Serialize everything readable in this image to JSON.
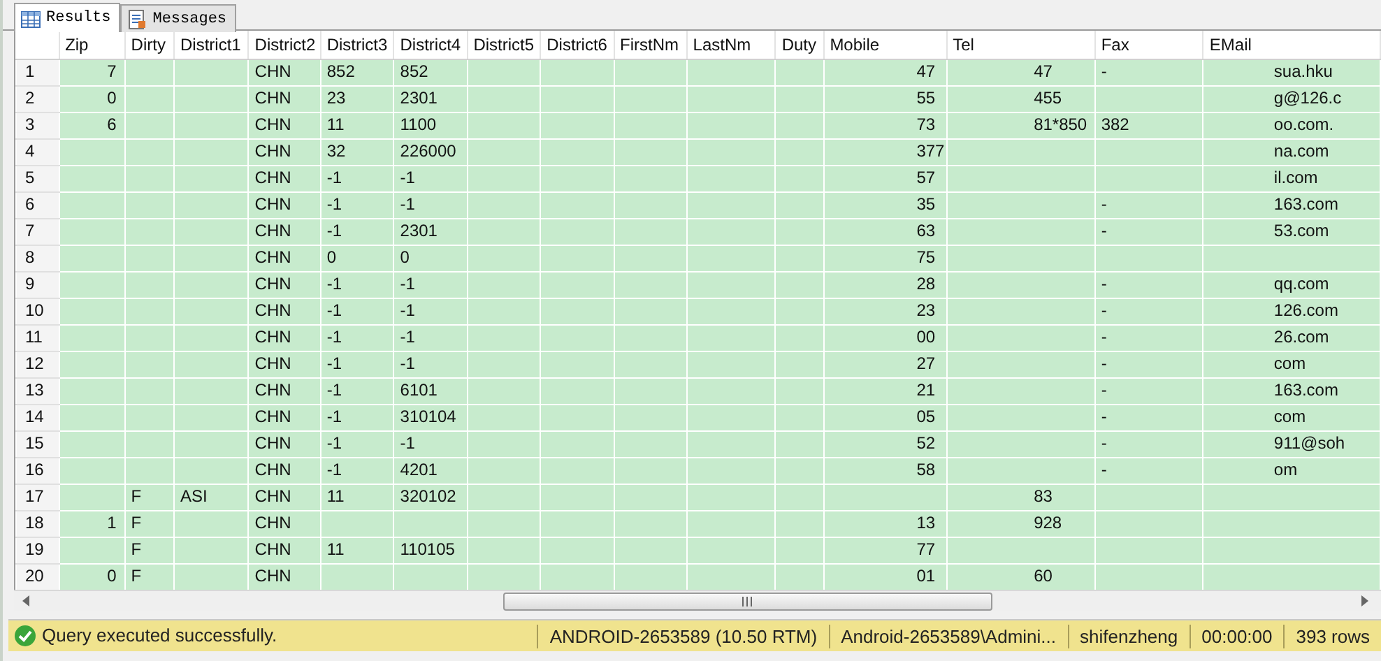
{
  "tabs": [
    {
      "label": "Results",
      "selected": true
    },
    {
      "label": "Messages",
      "selected": false
    }
  ],
  "table": {
    "columns": [
      "Zip",
      "Dirty",
      "District1",
      "District2",
      "District3",
      "District4",
      "District5",
      "District6",
      "FirstNm",
      "LastNm",
      "Duty",
      "Mobile",
      "Tel",
      "Fax",
      "EMail"
    ],
    "rows": [
      {
        "number": "1",
        "cells": [
          "7",
          "",
          "",
          "CHN",
          "852",
          "852",
          "",
          "",
          "",
          "",
          "",
          "47",
          "47",
          "-",
          "sua.hku"
        ]
      },
      {
        "number": "2",
        "cells": [
          "0",
          "",
          "",
          "CHN",
          "23",
          "2301",
          "",
          "",
          "",
          "",
          "",
          "55",
          "455",
          "",
          "g@126.c"
        ]
      },
      {
        "number": "3",
        "cells": [
          "6",
          "",
          "",
          "CHN",
          "11",
          "1100",
          "",
          "",
          "",
          "",
          "",
          "73",
          "81*850",
          "382",
          "oo.com."
        ]
      },
      {
        "number": "4",
        "cells": [
          "",
          "",
          "",
          "CHN",
          "32",
          "226000",
          "",
          "",
          "",
          "",
          "",
          "377",
          "",
          "",
          "na.com"
        ]
      },
      {
        "number": "5",
        "cells": [
          "",
          "",
          "",
          "CHN",
          "-1",
          "-1",
          "",
          "",
          "",
          "",
          "",
          "57",
          "",
          "",
          "il.com"
        ]
      },
      {
        "number": "6",
        "cells": [
          "",
          "",
          "",
          "CHN",
          "-1",
          "-1",
          "",
          "",
          "",
          "",
          "",
          "35",
          "",
          "-",
          "163.com"
        ]
      },
      {
        "number": "7",
        "cells": [
          "",
          "",
          "",
          "CHN",
          "-1",
          "2301",
          "",
          "",
          "",
          "",
          "",
          "63",
          "",
          "-",
          "53.com"
        ]
      },
      {
        "number": "8",
        "cells": [
          "",
          "",
          "",
          "CHN",
          "0",
          "0",
          "",
          "",
          "",
          "",
          "",
          "75",
          "",
          "",
          ""
        ]
      },
      {
        "number": "9",
        "cells": [
          "",
          "",
          "",
          "CHN",
          "-1",
          "-1",
          "",
          "",
          "",
          "",
          "",
          "28",
          "",
          "-",
          "qq.com"
        ]
      },
      {
        "number": "10",
        "cells": [
          "",
          "",
          "",
          "CHN",
          "-1",
          "-1",
          "",
          "",
          "",
          "",
          "",
          "23",
          "",
          "-",
          "126.com"
        ]
      },
      {
        "number": "11",
        "cells": [
          "",
          "",
          "",
          "CHN",
          "-1",
          "-1",
          "",
          "",
          "",
          "",
          "",
          "00",
          "",
          "-",
          "26.com"
        ]
      },
      {
        "number": "12",
        "cells": [
          "",
          "",
          "",
          "CHN",
          "-1",
          "-1",
          "",
          "",
          "",
          "",
          "",
          "27",
          "",
          "-",
          "com"
        ]
      },
      {
        "number": "13",
        "cells": [
          "",
          "",
          "",
          "CHN",
          "-1",
          "6101",
          "",
          "",
          "",
          "",
          "",
          "21",
          "",
          "-",
          "163.com"
        ]
      },
      {
        "number": "14",
        "cells": [
          "",
          "",
          "",
          "CHN",
          "-1",
          "310104",
          "",
          "",
          "",
          "",
          "",
          "05",
          "",
          "-",
          "com"
        ]
      },
      {
        "number": "15",
        "cells": [
          "",
          "",
          "",
          "CHN",
          "-1",
          "-1",
          "",
          "",
          "",
          "",
          "",
          "52",
          "",
          "-",
          "911@soh"
        ]
      },
      {
        "number": "16",
        "cells": [
          "",
          "",
          "",
          "CHN",
          "-1",
          "4201",
          "",
          "",
          "",
          "",
          "",
          "58",
          "",
          "-",
          "om"
        ]
      },
      {
        "number": "17",
        "cells": [
          "",
          "F",
          "ASI",
          "CHN",
          "11",
          "320102",
          "",
          "",
          "",
          "",
          "",
          "",
          "83",
          "",
          ""
        ]
      },
      {
        "number": "18",
        "cells": [
          "1",
          "F",
          "",
          "CHN",
          "",
          "",
          "",
          "",
          "",
          "",
          "",
          "13",
          "928",
          "",
          ""
        ]
      },
      {
        "number": "19",
        "cells": [
          "",
          "F",
          "",
          "CHN",
          "11",
          "110105",
          "",
          "",
          "",
          "",
          "",
          "77",
          "",
          "",
          ""
        ]
      },
      {
        "number": "20",
        "cells": [
          "0",
          "F",
          "",
          "CHN",
          "",
          "",
          "",
          "",
          "",
          "",
          "",
          "01",
          "60",
          "",
          ""
        ]
      }
    ]
  },
  "status_bar": {
    "message": "Query executed successfully.",
    "server": "ANDROID-2653589 (10.50 RTM)",
    "user": "Android-2653589\\Admini...",
    "database": "shifenzheng",
    "elapsed": "00:00:00",
    "rows": "393 rows"
  }
}
